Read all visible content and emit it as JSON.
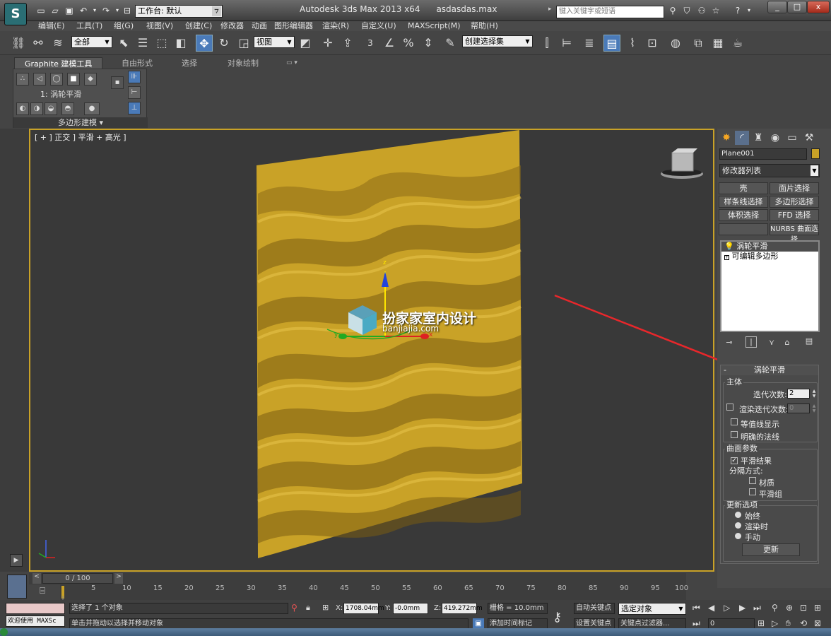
{
  "app": {
    "title": "Autodesk 3ds Max 2013 x64",
    "filename": "asdasdas.max",
    "logo": "S",
    "workspace_label": "工作台: 默认"
  },
  "search": {
    "placeholder": "键入关键字或短语"
  },
  "window_controls": {
    "minimize": "_",
    "maximize": "□",
    "close": "x"
  },
  "menus": [
    {
      "label": "编辑(E)"
    },
    {
      "label": "工具(T)"
    },
    {
      "label": "组(G)"
    },
    {
      "label": "视图(V)"
    },
    {
      "label": "创建(C)"
    },
    {
      "label": "修改器"
    },
    {
      "label": "动画"
    },
    {
      "label": "图形编辑器"
    },
    {
      "label": "渲染(R)"
    },
    {
      "label": "自定义(U)"
    },
    {
      "label": "MAXScript(M)"
    },
    {
      "label": "帮助(H)"
    }
  ],
  "toolbar": {
    "selection_filter": "全部",
    "ref_coord": "视图",
    "named_selection": "创建选择集",
    "snap_label": "3"
  },
  "ribbon": {
    "tabs": [
      "Graphite 建模工具",
      "自由形式",
      "选择",
      "对象绘制"
    ],
    "panel_item": "1: 涡轮平滑",
    "panel_title": "多边形建模 ▾"
  },
  "viewport": {
    "label": "[ + ] 正交 ] 平滑 + 高光 ]",
    "watermark_title": "扮家家室内设计",
    "watermark_url": "banjiajia.com",
    "object_color": "#c9a227",
    "border_color": "#c9a227",
    "gizmo_labels": {
      "z": "z",
      "x": "x",
      "y": "y"
    }
  },
  "command_panel": {
    "object_name": "Plane001",
    "modifier_list": "修改器列表",
    "buttons": [
      "壳",
      "面片选择",
      "样条线选择",
      "多边形选择",
      "体积选择",
      "FFD 选择",
      "",
      "NURBS 曲面选择"
    ],
    "stack": [
      "涡轮平滑",
      "可编辑多边形"
    ],
    "rollout_title": "涡轮平滑",
    "main_group": "主体",
    "iterations_label": "迭代次数:",
    "iterations_value": "2",
    "render_iters_label": "渲染迭代次数:",
    "render_iters_value": "0",
    "isoline_label": "等值线显示",
    "explicit_normals_label": "明确的法线",
    "surface_group": "曲面参数",
    "smooth_result_label": "平滑结果",
    "separate_by_label": "分隔方式:",
    "materials_label": "材质",
    "smoothing_groups_label": "平滑组",
    "update_group": "更新选项",
    "always_label": "始终",
    "when_rendering_label": "渲染时",
    "manually_label": "手动",
    "update_button": "更新"
  },
  "timeline": {
    "frame": "0 / 100",
    "ticks": [
      "0",
      "5",
      "10",
      "15",
      "20",
      "25",
      "30",
      "35",
      "40",
      "45",
      "50",
      "55",
      "60",
      "65",
      "70",
      "75",
      "80",
      "85",
      "90",
      "95",
      "100"
    ]
  },
  "status": {
    "maxscript": "欢迎使用 MAXSc",
    "selected": "选择了 1 个对象",
    "prompt": "单击并拖动以选择并移动对象",
    "x_label": "X:",
    "x": "1708.04mm",
    "y_label": "Y:",
    "y": "-0.0mm",
    "z_label": "Z:",
    "z": "419.272mm",
    "grid": "栅格 = 10.0mm",
    "add_time_tag": "添加时间标记",
    "auto_key": "自动关键点",
    "set_key": "设置关键点",
    "selected_obj": "选定对象",
    "key_filters": "关键点过滤器...",
    "frame_field": "0"
  }
}
